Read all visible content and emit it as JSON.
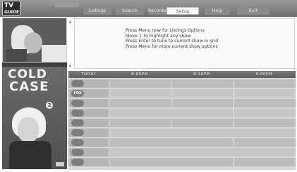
{
  "header": {
    "logo_top": "TV",
    "logo_bottom": "GUIDE",
    "small_tab_label": "",
    "tabs": [
      {
        "label": "Listings",
        "active": false
      },
      {
        "label": "Search",
        "active": false
      },
      {
        "label": "Recorded",
        "active": false
      },
      {
        "label": "Setup",
        "active": true
      },
      {
        "label": "Help",
        "active": false
      },
      {
        "label": "Exit",
        "active": false
      }
    ]
  },
  "promo": {
    "title_line1": "COLD",
    "title_line2": "CASE",
    "subtitle": "",
    "channel_badge": "2",
    "time": ""
  },
  "info": {
    "badge": "",
    "lines": [
      "Press Menu now for Listings Options",
      "Move ↓ to highlight any show",
      "Press Enter to tune to current show in grid",
      "Press Menu for more current show options"
    ]
  },
  "grid": {
    "columns": [
      "TODAY",
      "8:00PM",
      "8:30PM",
      "9:00PM"
    ],
    "rows": [
      {
        "logo": "",
        "number": "",
        "programs": [
          "",
          "",
          ""
        ]
      },
      {
        "logo": "FOX",
        "number": "",
        "programs": [
          "",
          "",
          ""
        ]
      },
      {
        "logo": "",
        "number": "",
        "programs": [
          "",
          "",
          ""
        ]
      },
      {
        "logo": "",
        "number": "",
        "programs": [
          "",
          ""
        ]
      },
      {
        "logo": "",
        "number": "",
        "programs": [
          "",
          "",
          ""
        ]
      },
      {
        "logo": "",
        "number": "",
        "programs": [
          ""
        ]
      },
      {
        "logo": "",
        "number": "",
        "programs": [
          "",
          ""
        ]
      },
      {
        "logo": "",
        "number": "",
        "programs": [
          ""
        ]
      },
      {
        "logo": "",
        "number": "",
        "programs": [
          "",
          ""
        ]
      }
    ]
  },
  "colors": {
    "accent": "#7a7a7a",
    "background": "#ffffff"
  }
}
